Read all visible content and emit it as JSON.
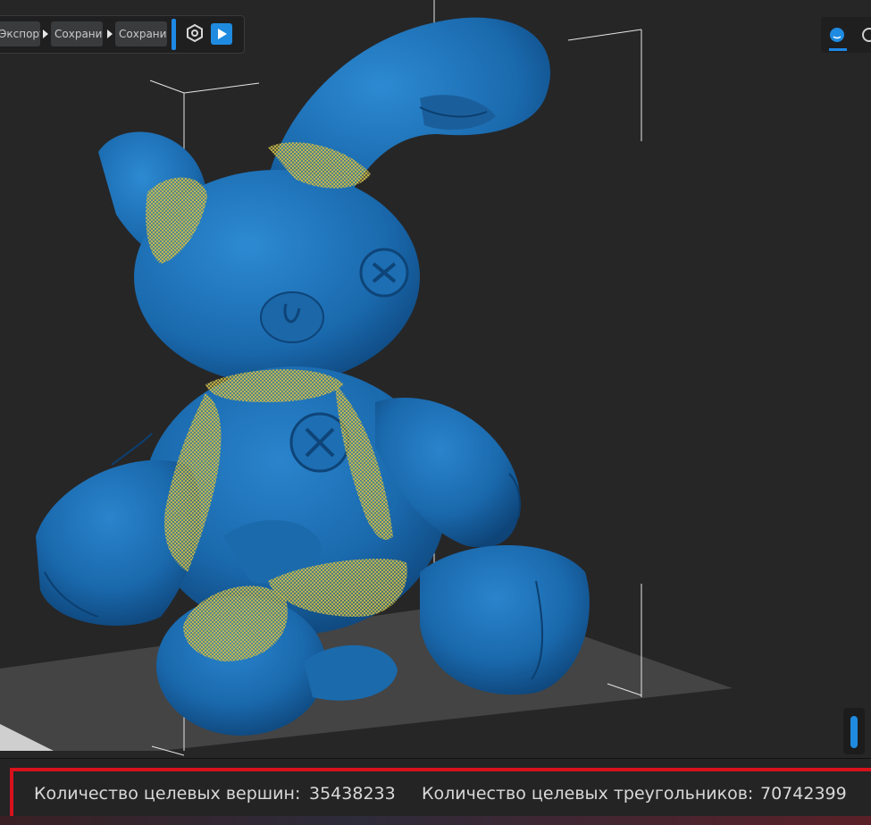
{
  "toolbar": {
    "crumbs": [
      "Экспорт...",
      "Сохрани...",
      "Сохрани..."
    ],
    "settings_icon": "hexagon-gear-icon",
    "run_icon": "play-icon"
  },
  "view_switch": {
    "active_icon": "sphere-shaded-icon",
    "other_icon": "sphere-wire-icon"
  },
  "status": {
    "vertices_label": "Количество целевых вершин:",
    "vertices_value": "35438233",
    "triangles_label": "Количество целевых треугольников:",
    "triangles_value": "70742399"
  },
  "colors": {
    "model": "#1c6fb3",
    "highlight": "#c8b43a",
    "accent": "#1f8be0",
    "frame": "#d8121c"
  }
}
